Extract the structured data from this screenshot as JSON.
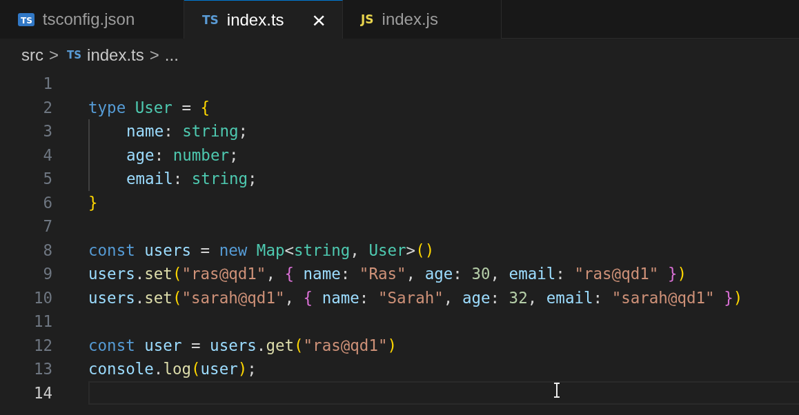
{
  "tabs": [
    {
      "icon_label": "TS",
      "kind": "badge",
      "label": "tsconfig.json",
      "selected": false
    },
    {
      "icon_label": "TS",
      "kind": "ts",
      "label": "index.ts",
      "selected": true,
      "close_glyph": "×"
    },
    {
      "icon_label": "JS",
      "kind": "js",
      "label": "index.js",
      "selected": false
    }
  ],
  "breadcrumb": [
    {
      "kind": "folder",
      "text": "src"
    },
    {
      "kind": "file",
      "icon_label": "TS",
      "text": "index.ts"
    },
    {
      "kind": "more",
      "text": "..."
    }
  ],
  "breadcrumb_separator": ">",
  "lines": [
    {
      "number": "1",
      "current": false,
      "guide": false
    },
    {
      "number": "2",
      "current": false,
      "guide": false,
      "tokens": [
        {
          "text": "type ",
          "kind": "keyword"
        },
        {
          "text": "User",
          "kind": "type"
        },
        {
          "text": " = ",
          "kind": "plain"
        },
        {
          "text": "{",
          "kind": "brace"
        }
      ]
    },
    {
      "number": "3",
      "current": false,
      "guide": true,
      "tokens": [
        {
          "text": "name",
          "kind": "var"
        },
        {
          "text": ": ",
          "kind": "plain"
        },
        {
          "text": "string",
          "kind": "type"
        },
        {
          "text": ";",
          "kind": "plain"
        }
      ]
    },
    {
      "number": "4",
      "current": false,
      "guide": true,
      "tokens": [
        {
          "text": "age",
          "kind": "var"
        },
        {
          "text": ": ",
          "kind": "plain"
        },
        {
          "text": "number",
          "kind": "type"
        },
        {
          "text": ";",
          "kind": "plain"
        }
      ]
    },
    {
      "number": "5",
      "current": false,
      "guide": true,
      "tokens": [
        {
          "text": "email",
          "kind": "var"
        },
        {
          "text": ": ",
          "kind": "plain"
        },
        {
          "text": "string",
          "kind": "type"
        },
        {
          "text": ";",
          "kind": "plain"
        }
      ]
    },
    {
      "number": "6",
      "current": false,
      "guide": false,
      "tokens": [
        {
          "text": "}",
          "kind": "brace"
        }
      ]
    },
    {
      "number": "7",
      "current": false,
      "guide": false
    },
    {
      "number": "8",
      "current": false,
      "guide": false,
      "tokens": [
        {
          "text": "const ",
          "kind": "keyword"
        },
        {
          "text": "users",
          "kind": "var"
        },
        {
          "text": " = ",
          "kind": "plain"
        },
        {
          "text": "new ",
          "kind": "keyword"
        },
        {
          "text": "Map",
          "kind": "type"
        },
        {
          "text": "<",
          "kind": "plain"
        },
        {
          "text": "string",
          "kind": "type"
        },
        {
          "text": ", ",
          "kind": "plain"
        },
        {
          "text": "User",
          "kind": "type"
        },
        {
          "text": ">",
          "kind": "plain"
        },
        {
          "text": "()",
          "kind": "brace"
        }
      ]
    },
    {
      "number": "9",
      "current": false,
      "guide": false,
      "tokens": [
        {
          "text": "users",
          "kind": "var"
        },
        {
          "text": ".",
          "kind": "plain"
        },
        {
          "text": "set",
          "kind": "func"
        },
        {
          "text": "(",
          "kind": "brace"
        },
        {
          "text": "\"ras@qd1\"",
          "kind": "string"
        },
        {
          "text": ", ",
          "kind": "plain"
        },
        {
          "text": "{",
          "kind": "paren"
        },
        {
          "text": " name",
          "kind": "var"
        },
        {
          "text": ": ",
          "kind": "plain"
        },
        {
          "text": "\"Ras\"",
          "kind": "string"
        },
        {
          "text": ", ",
          "kind": "plain"
        },
        {
          "text": "age",
          "kind": "var"
        },
        {
          "text": ": ",
          "kind": "plain"
        },
        {
          "text": "30",
          "kind": "number"
        },
        {
          "text": ", ",
          "kind": "plain"
        },
        {
          "text": "email",
          "kind": "var"
        },
        {
          "text": ": ",
          "kind": "plain"
        },
        {
          "text": "\"ras@qd1\" ",
          "kind": "string"
        },
        {
          "text": "}",
          "kind": "paren"
        },
        {
          "text": ")",
          "kind": "brace"
        }
      ]
    },
    {
      "number": "10",
      "current": false,
      "guide": false,
      "tokens": [
        {
          "text": "users",
          "kind": "var"
        },
        {
          "text": ".",
          "kind": "plain"
        },
        {
          "text": "set",
          "kind": "func"
        },
        {
          "text": "(",
          "kind": "brace"
        },
        {
          "text": "\"sarah@qd1\"",
          "kind": "string"
        },
        {
          "text": ", ",
          "kind": "plain"
        },
        {
          "text": "{",
          "kind": "paren"
        },
        {
          "text": " name",
          "kind": "var"
        },
        {
          "text": ": ",
          "kind": "plain"
        },
        {
          "text": "\"Sarah\"",
          "kind": "string"
        },
        {
          "text": ", ",
          "kind": "plain"
        },
        {
          "text": "age",
          "kind": "var"
        },
        {
          "text": ": ",
          "kind": "plain"
        },
        {
          "text": "32",
          "kind": "number"
        },
        {
          "text": ", ",
          "kind": "plain"
        },
        {
          "text": "email",
          "kind": "var"
        },
        {
          "text": ": ",
          "kind": "plain"
        },
        {
          "text": "\"sarah@qd1\" ",
          "kind": "string"
        },
        {
          "text": "}",
          "kind": "paren"
        },
        {
          "text": ")",
          "kind": "brace"
        }
      ]
    },
    {
      "number": "11",
      "current": false,
      "guide": false
    },
    {
      "number": "12",
      "current": false,
      "guide": false,
      "tokens": [
        {
          "text": "const ",
          "kind": "keyword"
        },
        {
          "text": "user",
          "kind": "var"
        },
        {
          "text": " = ",
          "kind": "plain"
        },
        {
          "text": "users",
          "kind": "var"
        },
        {
          "text": ".",
          "kind": "plain"
        },
        {
          "text": "get",
          "kind": "func"
        },
        {
          "text": "(",
          "kind": "brace"
        },
        {
          "text": "\"ras@qd1\"",
          "kind": "string"
        },
        {
          "text": ")",
          "kind": "brace"
        }
      ]
    },
    {
      "number": "13",
      "current": false,
      "guide": false,
      "tokens": [
        {
          "text": "console",
          "kind": "var"
        },
        {
          "text": ".",
          "kind": "plain"
        },
        {
          "text": "log",
          "kind": "func"
        },
        {
          "text": "(",
          "kind": "brace"
        },
        {
          "text": "user",
          "kind": "var"
        },
        {
          "text": ")",
          "kind": "brace"
        },
        {
          "text": ";",
          "kind": "plain"
        }
      ]
    },
    {
      "number": "14",
      "current": true,
      "guide": false
    }
  ]
}
